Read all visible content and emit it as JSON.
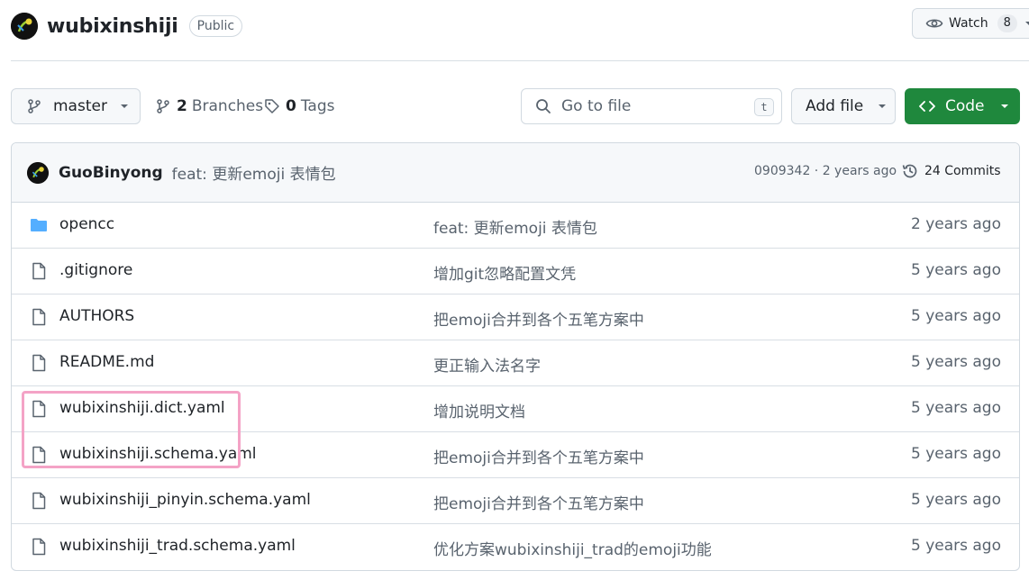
{
  "repo": {
    "name": "wubixinshiji",
    "visibility": "Public",
    "watch_label": "Watch",
    "watch_count": "8"
  },
  "toolbar": {
    "branch": "master",
    "branches_count": "2",
    "branches_label": "Branches",
    "tags_count": "0",
    "tags_label": "Tags",
    "search_placeholder": "Go to file",
    "search_shortcut": "t",
    "add_file_label": "Add file",
    "code_label": "Code"
  },
  "latest_commit": {
    "author": "GuoBinyong",
    "message": "feat: 更新emoji 表情包",
    "meta": "0909342 · 2 years ago",
    "commits_label": "24 Commits"
  },
  "files": [
    {
      "name": "opencc",
      "type": "folder",
      "commit": "feat: 更新emoji 表情包",
      "age": "2 years ago"
    },
    {
      "name": ".gitignore",
      "type": "file",
      "commit": "增加git忽略配置文凭",
      "age": "5 years ago"
    },
    {
      "name": "AUTHORS",
      "type": "file",
      "commit": "把emoji合并到各个五笔方案中",
      "age": "5 years ago"
    },
    {
      "name": "README.md",
      "type": "file",
      "commit": "更正输入法名字",
      "age": "5 years ago"
    },
    {
      "name": "wubixinshiji.dict.yaml",
      "type": "file",
      "commit": "增加说明文档",
      "age": "5 years ago"
    },
    {
      "name": "wubixinshiji.schema.yaml",
      "type": "file",
      "commit": "把emoji合并到各个五笔方案中",
      "age": "5 years ago"
    },
    {
      "name": "wubixinshiji_pinyin.schema.yaml",
      "type": "file",
      "commit": "把emoji合并到各个五笔方案中",
      "age": "5 years ago"
    },
    {
      "name": "wubixinshiji_trad.schema.yaml",
      "type": "file",
      "commit": "优化方案wubixinshiji_trad的emoji功能",
      "age": "5 years ago"
    }
  ],
  "colors": {
    "code_button": "#1f883d",
    "folder_icon": "#54aeff",
    "highlight": "#f4a3c6"
  }
}
